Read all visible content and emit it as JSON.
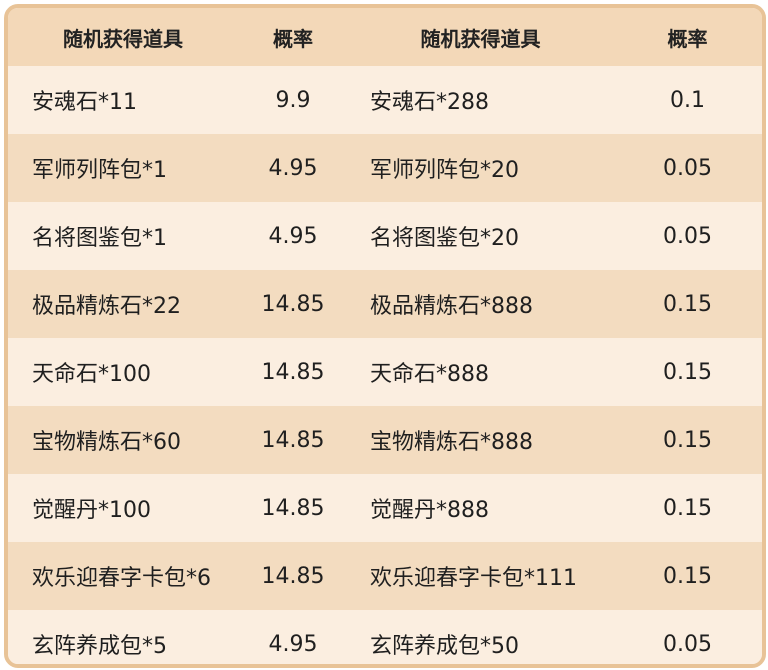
{
  "table": {
    "headers": [
      "随机获得道具",
      "概率",
      "随机获得道具",
      "概率"
    ],
    "rows": [
      {
        "item1": "安魂石*11",
        "rate1": "9.9",
        "item2": "安魂石*288",
        "rate2": "0.1"
      },
      {
        "item1": "军师列阵包*1",
        "rate1": "4.95",
        "item2": "军师列阵包*20",
        "rate2": "0.05"
      },
      {
        "item1": "名将图鉴包*1",
        "rate1": "4.95",
        "item2": "名将图鉴包*20",
        "rate2": "0.05"
      },
      {
        "item1": "极品精炼石*22",
        "rate1": "14.85",
        "item2": "极品精炼石*888",
        "rate2": "0.15"
      },
      {
        "item1": "天命石*100",
        "rate1": "14.85",
        "item2": "天命石*888",
        "rate2": "0.15"
      },
      {
        "item1": "宝物精炼石*60",
        "rate1": "14.85",
        "item2": "宝物精炼石*888",
        "rate2": "0.15"
      },
      {
        "item1": "觉醒丹*100",
        "rate1": "14.85",
        "item2": "觉醒丹*888",
        "rate2": "0.15"
      },
      {
        "item1": "欢乐迎春字卡包*6",
        "rate1": "14.85",
        "item2": "欢乐迎春字卡包*111",
        "rate2": "0.15"
      },
      {
        "item1": "玄阵养成包*5",
        "rate1": "4.95",
        "item2": "玄阵养成包*50",
        "rate2": "0.05"
      }
    ]
  },
  "colors": {
    "border": "#e8c397",
    "header_bg": "#f3d8b8",
    "row_light": "#fbeee0",
    "row_dark": "#f3dcc0"
  }
}
